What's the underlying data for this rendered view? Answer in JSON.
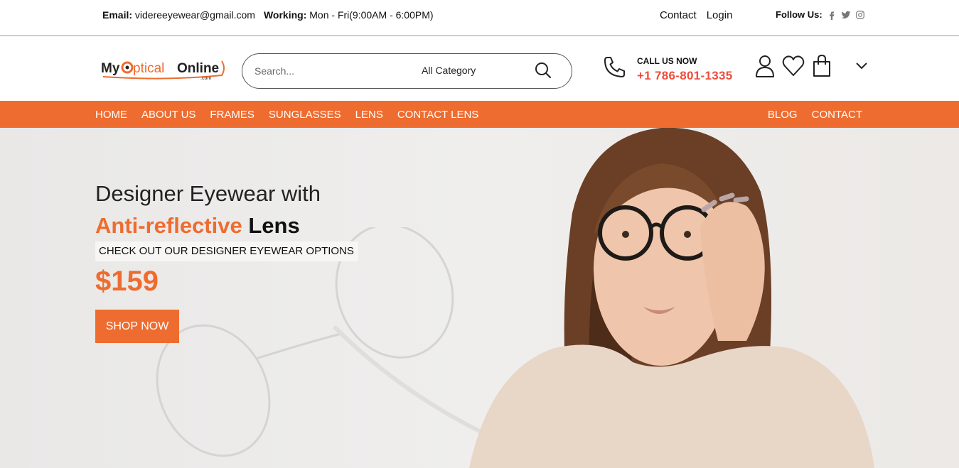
{
  "topbar": {
    "email_label": "Email:",
    "email_value": "videreeyewear@gmail.com",
    "working_label": "Working:",
    "working_value": "Mon - Fri(9:00AM - 6:00PM)",
    "contact_link": "Contact",
    "login_link": "Login",
    "follow_label": "Follow Us:",
    "social_icons": [
      "facebook-icon",
      "twitter-icon",
      "instagram-icon"
    ]
  },
  "header": {
    "logo_text_my": "My",
    "logo_text_optical": "ptical",
    "logo_text_online": "Online",
    "logo_text_com": ".com",
    "search_placeholder": "Search...",
    "search_category": "All Category",
    "call_label": "CALL US NOW",
    "call_number": "+1 786-801-1335",
    "icons": [
      "user-icon",
      "heart-icon",
      "cart-icon",
      "chevron-down-icon"
    ]
  },
  "nav": {
    "left_items": [
      "HOME",
      "ABOUT US",
      "FRAMES",
      "SUNGLASSES",
      "LENS",
      "CONTACT LENS"
    ],
    "right_items": [
      "BLOG",
      "CONTACT"
    ]
  },
  "hero": {
    "line1": "Designer Eyewear with",
    "line2_accent": "Anti-reflective",
    "line2_dark": "Lens",
    "subtitle": "CHECK OUT OUR DESIGNER EYEWEAR OPTIONS",
    "price": "$159",
    "cta": "SHOP NOW"
  },
  "colors": {
    "accent": "#ee6c2f",
    "phone": "#ee4d3c",
    "hero_bg": "#eceae8"
  }
}
